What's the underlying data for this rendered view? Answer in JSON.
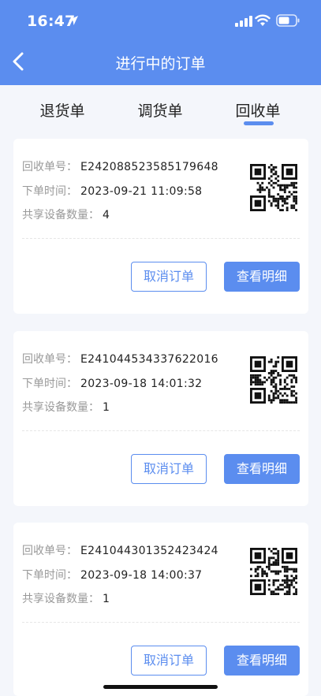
{
  "status_bar": {
    "time": "16:47"
  },
  "nav": {
    "title": "进行中的订单"
  },
  "tabs": [
    {
      "label": "退货单"
    },
    {
      "label": "调货单"
    },
    {
      "label": "回收单",
      "active": true
    }
  ],
  "labels": {
    "order_no": "回收单号：",
    "order_time": "下单时间：",
    "device_count": "共享设备数量："
  },
  "orders": [
    {
      "order_no": "E242088523585179648",
      "order_time": "2023-09-21 11:09:58",
      "device_count": "4",
      "cancel_label": "取消订单",
      "detail_label": "查看明细"
    },
    {
      "order_no": "E241044534337622016",
      "order_time": "2023-09-18 14:01:32",
      "device_count": "1",
      "cancel_label": "取消订单",
      "detail_label": "查看明细"
    },
    {
      "order_no": "E241044301352423424",
      "order_time": "2023-09-18 14:00:37",
      "device_count": "1",
      "cancel_label": "取消订单",
      "detail_label": "查看明细"
    }
  ],
  "colors": {
    "primary": "#5b8def",
    "background": "#f4f6fb"
  },
  "icons": [
    "location-arrow-icon",
    "signal-icon",
    "wifi-icon",
    "battery-icon",
    "back-chevron-icon",
    "qr-code-icon"
  ]
}
